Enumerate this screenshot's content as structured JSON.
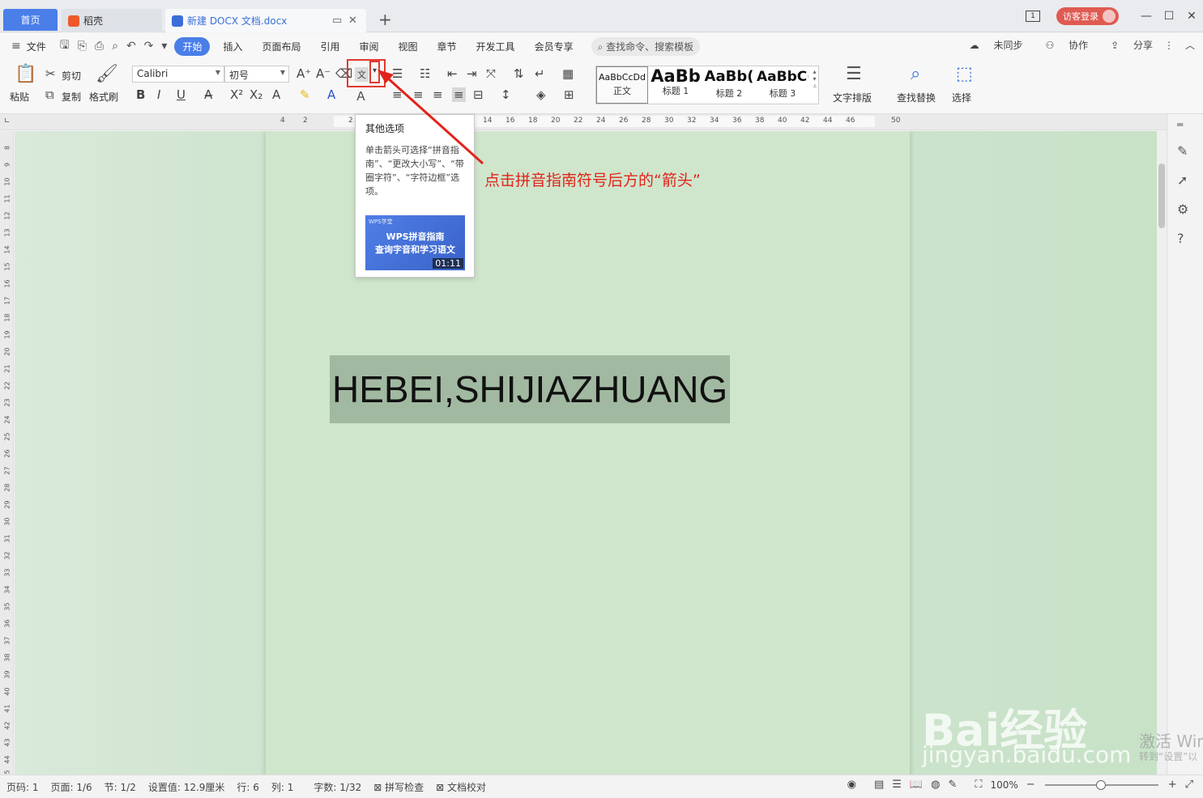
{
  "tabs": {
    "home": "首页",
    "docer": "稻壳",
    "document": "新建 DOCX 文档.docx",
    "add": "+"
  },
  "topbar": {
    "window_count": "1",
    "login": "访客登录"
  },
  "menu": {
    "file": "文件",
    "items": [
      "开始",
      "插入",
      "页面布局",
      "引用",
      "审阅",
      "视图",
      "章节",
      "开发工具",
      "会员专享"
    ],
    "search": "查找命令、搜索模板",
    "sync": "未同步",
    "collab": "协作",
    "share": "分享"
  },
  "ribbon": {
    "paste": "粘贴",
    "cut": "剪切",
    "copy": "复制",
    "format_painter": "格式刷",
    "font_name": "Calibri",
    "font_size": "初号",
    "styles": [
      {
        "preview": "AaBbCcDd",
        "name": "正文"
      },
      {
        "preview": "AaBb",
        "name": "标题 1"
      },
      {
        "preview": "AaBb(",
        "name": "标题 2"
      },
      {
        "preview": "AaBbC(",
        "name": "标题 3"
      }
    ],
    "text_layout": "文字排版",
    "find_replace": "查找替换",
    "select": "选择"
  },
  "ruler": {
    "ticks": [
      "4",
      "2",
      "2",
      "14",
      "16",
      "18",
      "20",
      "22",
      "24",
      "26",
      "28",
      "30",
      "32",
      "34",
      "36",
      "38",
      "40",
      "42",
      "44",
      "46",
      "50"
    ],
    "vticks": [
      "8",
      "9",
      "10",
      "11",
      "12",
      "13",
      "14",
      "15",
      "16",
      "17",
      "18",
      "19",
      "20",
      "21",
      "22",
      "23",
      "24",
      "25",
      "26",
      "27",
      "28",
      "29",
      "30",
      "31",
      "32",
      "33",
      "34",
      "35",
      "36",
      "37",
      "38",
      "39",
      "40",
      "41",
      "42",
      "43",
      "44",
      "45"
    ]
  },
  "document": {
    "text": "HEBEI,SHIJIAZHUANG"
  },
  "tooltip": {
    "title": "其他选项",
    "body": "单击箭头可选择“拼音指南”、“更改大小写”、“带圈字符”、“字符边框”选项。",
    "video_logo": "WPS学堂",
    "video_line1": "WPS拼音指南",
    "video_line2": "查询字音和学习语文",
    "video_duration": "01:11"
  },
  "annotation": {
    "text": "点击拼音指南符号后方的“箭头”",
    "color": "#e2231a"
  },
  "watermark": {
    "baidu": "Bai经验",
    "url": "jingyan.baidu.com",
    "activate": "激活 Win",
    "activate_sub": "转到“设置”以"
  },
  "statusbar": {
    "page_code": "页码: 1",
    "page": "页面: 1/6",
    "section": "节: 1/2",
    "setting": "设置值: 12.9厘米",
    "row": "行: 6",
    "col": "列: 1",
    "words": "字数: 1/32",
    "spell": "拼写检查",
    "proof": "文档校对",
    "zoom": "100%"
  },
  "colors": {
    "accent": "#4a7ee8",
    "login": "#e05a52",
    "page_bg": "#cfe6cc",
    "selection": "#a1b9a1"
  }
}
